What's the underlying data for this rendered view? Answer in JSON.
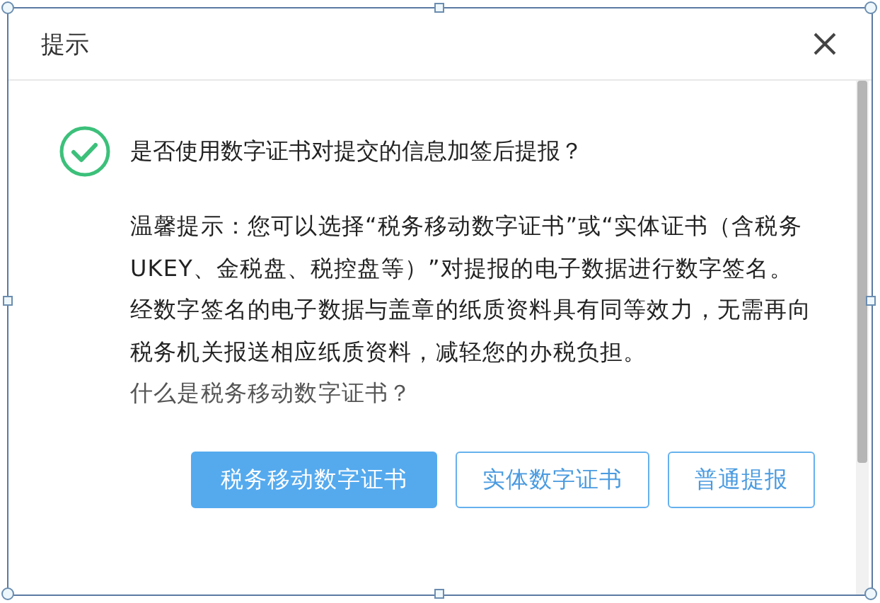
{
  "dialog": {
    "title": "提示",
    "question": "是否使用数字证书对提交的信息加签后提报？",
    "paragraphs": [
      "温馨提示：您可以选择“税务移动数字证书”或“实体证书（含税务UKEY、金税盘、税控盘等）”对提报的电子数据进行数字签名。",
      "经数字签名的电子数据与盖章的纸质资料具有同等效力，无需再向税务机关报送相应纸质资料，减轻您的办税负担。"
    ],
    "help_link": "什么是税务移动数字证书？",
    "buttons": [
      {
        "label": "税务移动数字证书",
        "kind": "primary"
      },
      {
        "label": "实体数字证书",
        "kind": "outline"
      },
      {
        "label": "普通提报",
        "kind": "outline"
      }
    ]
  }
}
